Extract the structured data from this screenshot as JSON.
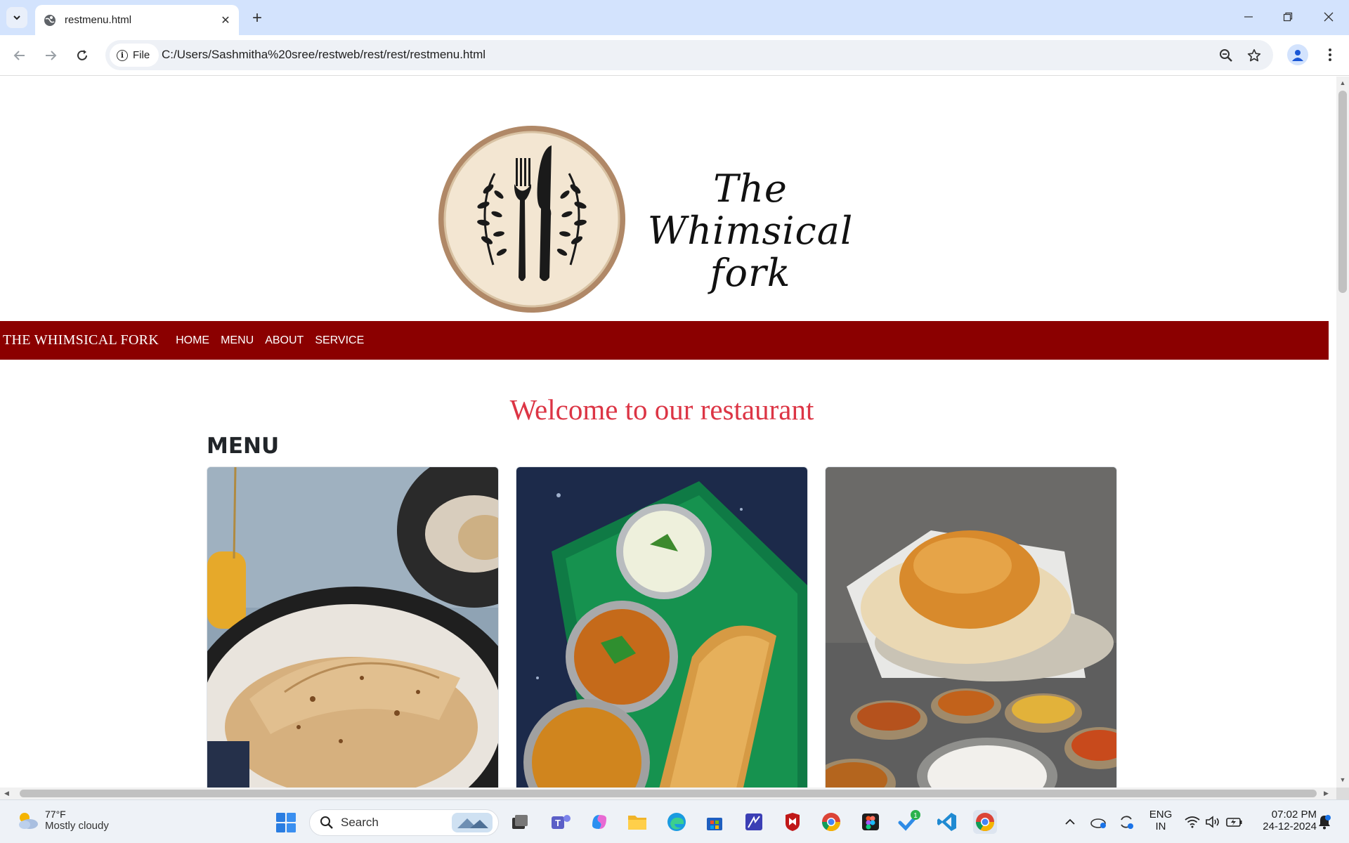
{
  "browser": {
    "tab_title": "restmenu.html",
    "chip_label": "File",
    "url": "C:/Users/Sashmitha%20sree/restweb/rest/rest/restmenu.html"
  },
  "logo": {
    "line1": "The Whimsical",
    "line2": "fork"
  },
  "navbar": {
    "brand": "THE WHIMSICAL FORK",
    "links": [
      "HOME",
      "MENU",
      "ABOUT",
      "SERVICE"
    ]
  },
  "main": {
    "welcome": "Welcome to our restaurant",
    "menu_heading": "MENU"
  },
  "menu_cards": [
    {
      "name": "chapati-card"
    },
    {
      "name": "dosa-card"
    },
    {
      "name": "poori-card"
    }
  ],
  "taskbar": {
    "temperature": "77°F",
    "weather": "Mostly cloudy",
    "search_label": "Search",
    "language": "ENG",
    "region": "IN",
    "time": "07:02 PM",
    "date": "24-12-2024",
    "teams_badge": "1"
  },
  "colors": {
    "navbar": "#8b0000",
    "welcome": "#dc3545",
    "tabbar": "#d3e3fd"
  }
}
